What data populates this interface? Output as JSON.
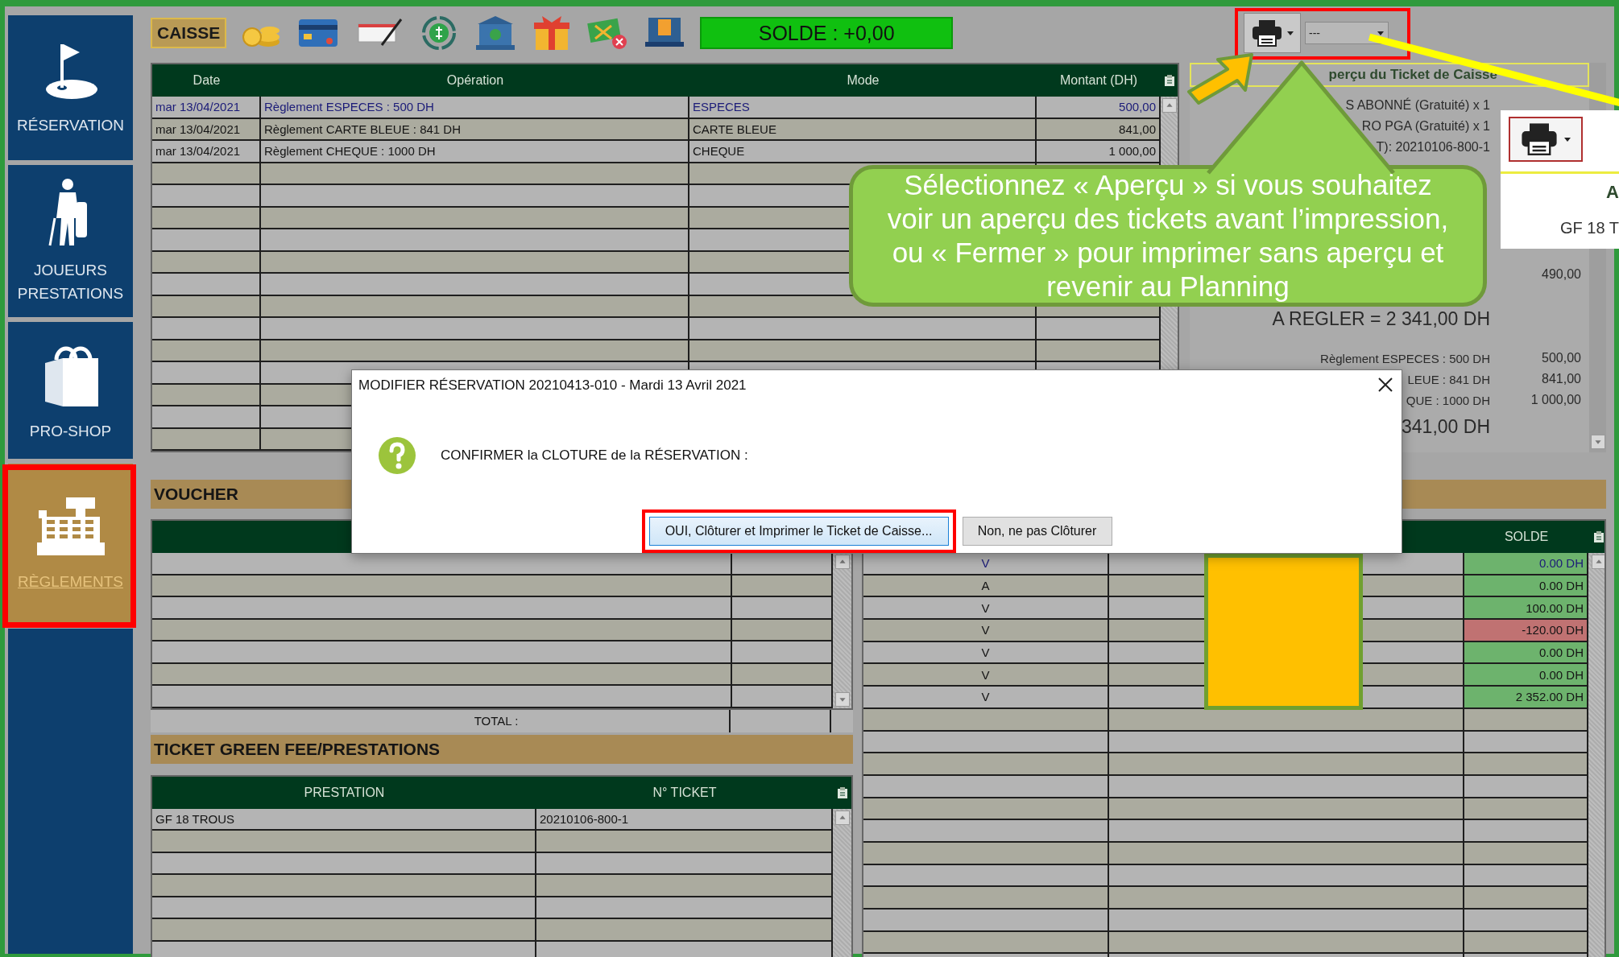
{
  "sidebar": {
    "items": [
      {
        "label": "RÉSERVATION",
        "kind": "flag",
        "selected": false
      },
      {
        "label": "JOUEURS PRESTATIONS",
        "kind": "player",
        "selected": false
      },
      {
        "label": "PRO-SHOP",
        "kind": "bag",
        "selected": false
      },
      {
        "label": "RÈGLEMENTS",
        "kind": "register",
        "selected": true
      }
    ]
  },
  "toolbar": {
    "label": "CAISSE",
    "balance": "SOLDE : +0,00"
  },
  "printer": {
    "dropdown_value": "---"
  },
  "operations": {
    "columns": [
      "Date",
      "Opération",
      "Mode",
      "Montant (DH)"
    ],
    "rows": [
      {
        "date": "mar 13/04/2021",
        "operation": "Règlement ESPECES : 500 DH",
        "mode": "ESPECES",
        "amount": "500,00",
        "selected": true
      },
      {
        "date": "mar 13/04/2021",
        "operation": "Règlement CARTE BLEUE : 841 DH",
        "mode": "CARTE BLEUE",
        "amount": "841,00",
        "selected": false
      },
      {
        "date": "mar 13/04/2021",
        "operation": "Règlement CHEQUE : 1000 DH",
        "mode": "CHEQUE",
        "amount": "1 000,00",
        "selected": false
      }
    ]
  },
  "ticket_preview": {
    "title": "perçu du Ticket de Caisse",
    "lines": [
      {
        "kind": "item",
        "text": "S ABONNÉ (Gratuité) x 1"
      },
      {
        "kind": "item",
        "text": "RO PGA (Gratuité) x 1"
      },
      {
        "kind": "item",
        "text": "T): 20210106-800-1"
      },
      {
        "kind": "amount",
        "amount": "490,00"
      },
      {
        "kind": "total",
        "text": "A REGLER = 2 341,00 DH"
      },
      {
        "kind": "payment",
        "text": "Règlement ESPECES : 500 DH",
        "amount": "500,00"
      },
      {
        "kind": "payment",
        "text": "LEUE : 841 DH",
        "amount": "841,00"
      },
      {
        "kind": "payment",
        "text": "QUE : 1000 DH",
        "amount": "1 000,00"
      },
      {
        "kind": "total",
        "text": "341,00 DH"
      }
    ]
  },
  "voucher": {
    "title": "VOUCHER",
    "total_label": "TOTAL :"
  },
  "balances": {
    "columns": [
      "SOLDE"
    ],
    "rows": [
      {
        "type": "V",
        "solde": "0.00 DH",
        "color": "#6db36d",
        "selected": true
      },
      {
        "type": "A",
        "solde": "0.00 DH",
        "color": "#6db36d",
        "selected": false
      },
      {
        "type": "V",
        "solde": "100.00 DH",
        "color": "#6db36d",
        "selected": false
      },
      {
        "type": "V",
        "solde": "-120.00 DH",
        "color": "#c07272",
        "selected": false
      },
      {
        "type": "V",
        "solde": "0.00 DH",
        "color": "#6db36d",
        "selected": false
      },
      {
        "type": "V",
        "solde": "0.00 DH",
        "color": "#6db36d",
        "selected": false
      },
      {
        "type": "V",
        "solde": "2 352.00 DH",
        "color": "#6db36d",
        "selected": false
      }
    ]
  },
  "tickets": {
    "title": "TICKET GREEN FEE/PRESTATIONS",
    "columns": [
      "PRESTATION",
      "N° TICKET"
    ],
    "rows": [
      {
        "prestation": "GF 18 TROUS",
        "ticket": "20210106-800-1"
      }
    ]
  },
  "dialog": {
    "title": "MODIFIER RÉSERVATION 20210413-010 - Mardi 13 Avril 2021",
    "message": "CONFIRMER la CLOTURE de la RÉSERVATION :",
    "buttons": [
      {
        "label": "OUI, Clôturer et Imprimer le Ticket de Caisse...",
        "highlighted": true
      },
      {
        "label": "Non, ne pas Clôturer",
        "highlighted": false
      }
    ]
  },
  "callout": {
    "text": "Sélectionnez « Aperçu » si vous souhaitez voir un aperçu des tickets avant l’impression, ou « Fermer » pour imprimer sans aperçu et revenir au Planning"
  },
  "inset": {
    "labels": [
      "A",
      "GF 18 T"
    ]
  }
}
